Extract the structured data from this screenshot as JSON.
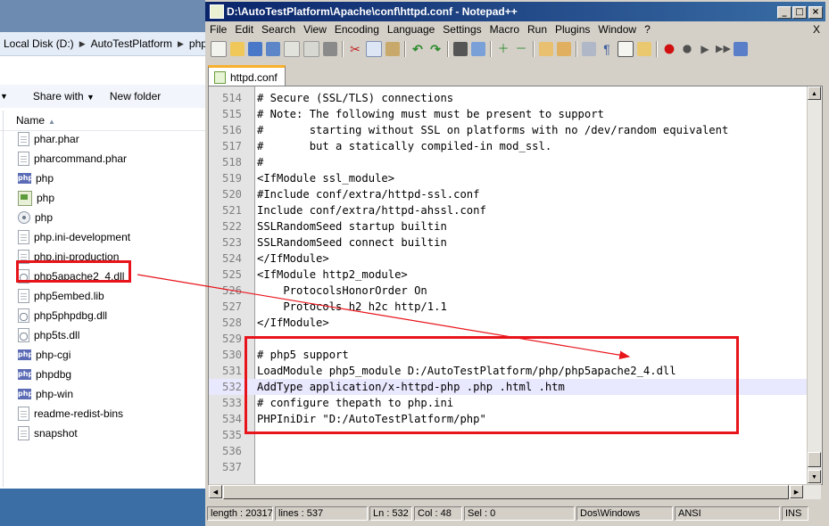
{
  "explorer": {
    "breadcrumb": [
      "Local Disk (D:)",
      "AutoTestPlatform",
      "php"
    ],
    "toolbar": {
      "share_with": "Share with",
      "new_folder": "New folder"
    },
    "column_name": "Name",
    "files": [
      {
        "name": "phar.phar",
        "icon": "document-icon"
      },
      {
        "name": "pharcommand.phar",
        "icon": "document-icon"
      },
      {
        "name": "php",
        "icon": "php-icon"
      },
      {
        "name": "php",
        "icon": "image-icon"
      },
      {
        "name": "php",
        "icon": "gear-icon"
      },
      {
        "name": "php.ini-development",
        "icon": "document-icon"
      },
      {
        "name": "php.ini-production",
        "icon": "document-icon"
      },
      {
        "name": "php5apache2_4.dll",
        "icon": "dll-icon"
      },
      {
        "name": "php5embed.lib",
        "icon": "document-icon"
      },
      {
        "name": "php5phpdbg.dll",
        "icon": "dll-icon"
      },
      {
        "name": "php5ts.dll",
        "icon": "dll-icon"
      },
      {
        "name": "php-cgi",
        "icon": "php-icon"
      },
      {
        "name": "phpdbg",
        "icon": "php-icon"
      },
      {
        "name": "php-win",
        "icon": "php-icon"
      },
      {
        "name": "readme-redist-bins",
        "icon": "document-icon"
      },
      {
        "name": "snapshot",
        "icon": "document-icon"
      }
    ]
  },
  "notepad": {
    "title": "D:\\AutoTestPlatform\\Apache\\conf\\httpd.conf - Notepad++",
    "menu": [
      "File",
      "Edit",
      "Search",
      "View",
      "Encoding",
      "Language",
      "Settings",
      "Macro",
      "Run",
      "Plugins",
      "Window",
      "?"
    ],
    "menu_close": "X",
    "tab": "httpd.conf",
    "lines": [
      {
        "n": "514",
        "t": "# Secure (SSL/TLS) connections"
      },
      {
        "n": "515",
        "t": "# Note: The following must must be present to support"
      },
      {
        "n": "516",
        "t": "#       starting without SSL on platforms with no /dev/random equivalent"
      },
      {
        "n": "517",
        "t": "#       but a statically compiled-in mod_ssl."
      },
      {
        "n": "518",
        "t": "#"
      },
      {
        "n": "519",
        "t": "<IfModule ssl_module>"
      },
      {
        "n": "520",
        "t": "#Include conf/extra/httpd-ssl.conf"
      },
      {
        "n": "521",
        "t": "Include conf/extra/httpd-ahssl.conf"
      },
      {
        "n": "522",
        "t": "SSLRandomSeed startup builtin"
      },
      {
        "n": "523",
        "t": "SSLRandomSeed connect builtin"
      },
      {
        "n": "524",
        "t": "</IfModule>"
      },
      {
        "n": "525",
        "t": "<IfModule http2_module>"
      },
      {
        "n": "526",
        "t": "    ProtocolsHonorOrder On"
      },
      {
        "n": "527",
        "t": "    Protocols h2 h2c http/1.1"
      },
      {
        "n": "528",
        "t": "</IfModule>"
      },
      {
        "n": "529",
        "t": ""
      },
      {
        "n": "530",
        "t": "# php5 support"
      },
      {
        "n": "531",
        "t": "LoadModule php5_module D:/AutoTestPlatform/php/php5apache2_4.dll"
      },
      {
        "n": "532",
        "t": "AddType application/x-httpd-php .php .html .htm"
      },
      {
        "n": "533",
        "t": "# configure thepath to php.ini"
      },
      {
        "n": "534",
        "t": "PHPIniDir \"D:/AutoTestPlatform/php\""
      },
      {
        "n": "535",
        "t": ""
      },
      {
        "n": "536",
        "t": ""
      },
      {
        "n": "537",
        "t": ""
      }
    ],
    "current_line": "532",
    "status": {
      "length": "length : 20317",
      "lines": "lines : 537",
      "ln": "Ln : 532",
      "col": "Col : 48",
      "sel": "Sel : 0",
      "eol": "Dos\\Windows",
      "encoding": "ANSI",
      "mode": "INS"
    }
  },
  "colors": {
    "annotation": "#e8141b",
    "current_line": "#e8e8ff",
    "title_bar": "#0a246a"
  }
}
